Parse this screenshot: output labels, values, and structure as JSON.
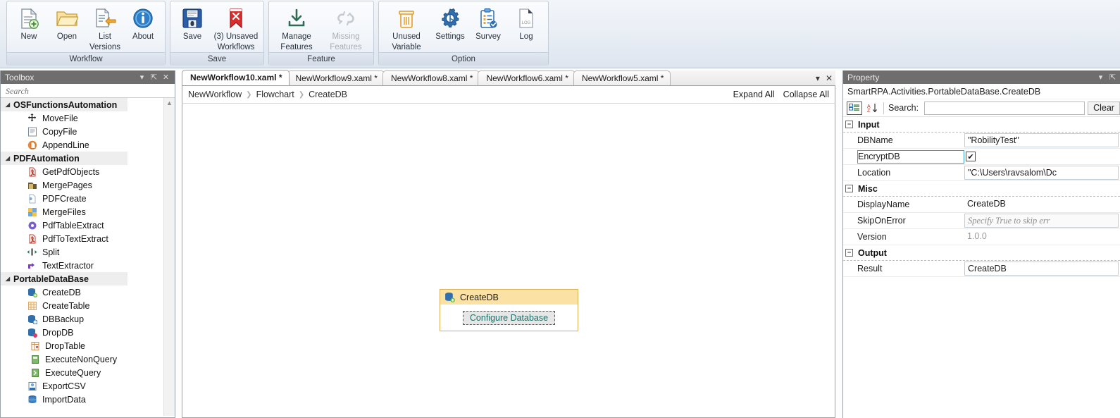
{
  "ribbon": {
    "groups": [
      {
        "title": "Workflow",
        "buttons": [
          {
            "label": "New",
            "icon": "new-document-icon",
            "enabled": true
          },
          {
            "label": "Open",
            "icon": "open-folder-icon",
            "enabled": true
          },
          {
            "label": "List\nVersions",
            "label_line1": "List",
            "label_line2": "Versions",
            "icon": "list-versions-icon",
            "enabled": true
          },
          {
            "label": "About",
            "icon": "about-info-icon",
            "enabled": true
          }
        ]
      },
      {
        "title": "Save",
        "buttons": [
          {
            "label": "Save",
            "icon": "floppy-save-icon",
            "enabled": true
          },
          {
            "label": "(3) Unsaved Workflows",
            "label_line1": "(3) Unsaved",
            "label_line2": "Workflows",
            "icon": "unsaved-bookmark-icon",
            "enabled": true
          }
        ]
      },
      {
        "title": "Feature",
        "buttons": [
          {
            "label": "Manage Features",
            "label_line1": "Manage",
            "label_line2": "Features",
            "icon": "download-manage-icon",
            "enabled": true
          },
          {
            "label": "Missing Features",
            "label_line1": "Missing",
            "label_line2": "Features",
            "icon": "broken-link-icon",
            "enabled": false
          }
        ]
      },
      {
        "title": "Option",
        "buttons": [
          {
            "label": "Unused Variable",
            "label_line1": "Unused",
            "label_line2": "Variable",
            "icon": "trash-can-icon",
            "enabled": true
          },
          {
            "label": "Settings",
            "icon": "gear-icon",
            "enabled": true
          },
          {
            "label": "Survey",
            "icon": "clipboard-check-icon",
            "enabled": true
          },
          {
            "label": "Log",
            "icon": "log-file-icon",
            "enabled": true
          }
        ]
      }
    ]
  },
  "toolbox": {
    "title": "Toolbox",
    "header_icons": [
      "chevron-down-icon",
      "pin-icon",
      "close-icon"
    ],
    "search": {
      "value": "",
      "placeholder": "Search"
    },
    "categories": [
      {
        "name": "OSFunctionsAutomation",
        "expanded": true,
        "items": [
          {
            "label": "MoveFile",
            "icon": "move-file-icon"
          },
          {
            "label": "CopyFile",
            "icon": "copy-file-icon"
          },
          {
            "label": "AppendLine",
            "icon": "append-line-icon"
          }
        ]
      },
      {
        "name": "PDFAutomation",
        "expanded": true,
        "items": [
          {
            "label": "GetPdfObjects",
            "icon": "pdf-objects-icon"
          },
          {
            "label": "MergePages",
            "icon": "merge-pages-icon"
          },
          {
            "label": "PDFCreate",
            "icon": "pdf-create-icon"
          },
          {
            "label": "MergeFiles",
            "icon": "merge-files-icon"
          },
          {
            "label": "PdfTableExtract",
            "icon": "pdf-table-extract-icon"
          },
          {
            "label": "PdfToTextExtract",
            "icon": "pdf-to-text-icon"
          },
          {
            "label": "Split",
            "icon": "split-icon"
          },
          {
            "label": "TextExtractor",
            "icon": "text-extractor-icon"
          }
        ]
      },
      {
        "name": "PortableDataBase",
        "expanded": true,
        "items": [
          {
            "label": "CreateDB",
            "icon": "create-db-icon"
          },
          {
            "label": "CreateTable",
            "icon": "create-table-icon"
          },
          {
            "label": "DBBackup",
            "icon": "db-backup-icon"
          },
          {
            "label": "DropDB",
            "icon": "drop-db-icon"
          },
          {
            "label": "DropTable",
            "icon": "drop-table-icon"
          },
          {
            "label": "ExecuteNonQuery",
            "icon": "execute-non-query-icon"
          },
          {
            "label": "ExecuteQuery",
            "icon": "execute-query-icon"
          },
          {
            "label": "ExportCSV",
            "icon": "export-csv-icon"
          },
          {
            "label": "ImportData",
            "icon": "import-data-icon"
          }
        ]
      }
    ]
  },
  "designer": {
    "tabs": [
      {
        "label": "NewWorkflow10.xaml *",
        "active": true
      },
      {
        "label": "NewWorkflow9.xaml *",
        "active": false
      },
      {
        "label": "NewWorkflow8.xaml *",
        "active": false
      },
      {
        "label": "NewWorkflow6.xaml *",
        "active": false
      },
      {
        "label": "NewWorkflow5.xaml *",
        "active": false
      }
    ],
    "tab_controls": [
      "chevron-down-icon",
      "close-icon"
    ],
    "breadcrumb": [
      "NewWorkflow",
      "Flowchart",
      "CreateDB"
    ],
    "actions": {
      "expand_all": "Expand All",
      "collapse_all": "Collapse All"
    },
    "node": {
      "title": "CreateDB",
      "icon": "create-db-icon",
      "button_label": "Configure Database"
    }
  },
  "property": {
    "title": "Property",
    "header_icons": [
      "chevron-down-icon",
      "pin-icon"
    ],
    "type_name": "SmartRPA.Activities.PortableDataBase.CreateDB",
    "toolbar": {
      "categorize_icon": "categorized-view-icon",
      "sort_icon": "sort-alpha-icon",
      "search_label": "Search:",
      "search_value": "",
      "clear_label": "Clear"
    },
    "sections": [
      {
        "name": "Input",
        "expanded": true,
        "rows": [
          {
            "name": "DBName",
            "value": "\"RobilityTest\"",
            "kind": "textbox",
            "focused": false
          },
          {
            "name": "EncryptDB",
            "value": "✔",
            "kind": "checkbox",
            "checked": true,
            "focused": true
          },
          {
            "name": "Location",
            "value": "\"C:\\Users\\ravsalom\\Dc",
            "kind": "textbox",
            "focused": false
          }
        ]
      },
      {
        "name": "Misc",
        "expanded": true,
        "rows": [
          {
            "name": "DisplayName",
            "value": "CreateDB",
            "kind": "plain",
            "focused": false
          },
          {
            "name": "SkipOnError",
            "value": "Specify True to skip err",
            "kind": "placeholder",
            "focused": false
          },
          {
            "name": "Version",
            "value": "1.0.0",
            "kind": "muted",
            "focused": false
          }
        ]
      },
      {
        "name": "Output",
        "expanded": true,
        "rows": [
          {
            "name": "Result",
            "value": "CreateDB",
            "kind": "textbox",
            "focused": false
          }
        ]
      }
    ]
  },
  "colors": {
    "panel_header": "#6e6e6e",
    "node_header": "#fbe2a4",
    "node_border": "#d9b45c",
    "accent_blue": "#2f6fad",
    "link_teal": "#1d6f68"
  }
}
